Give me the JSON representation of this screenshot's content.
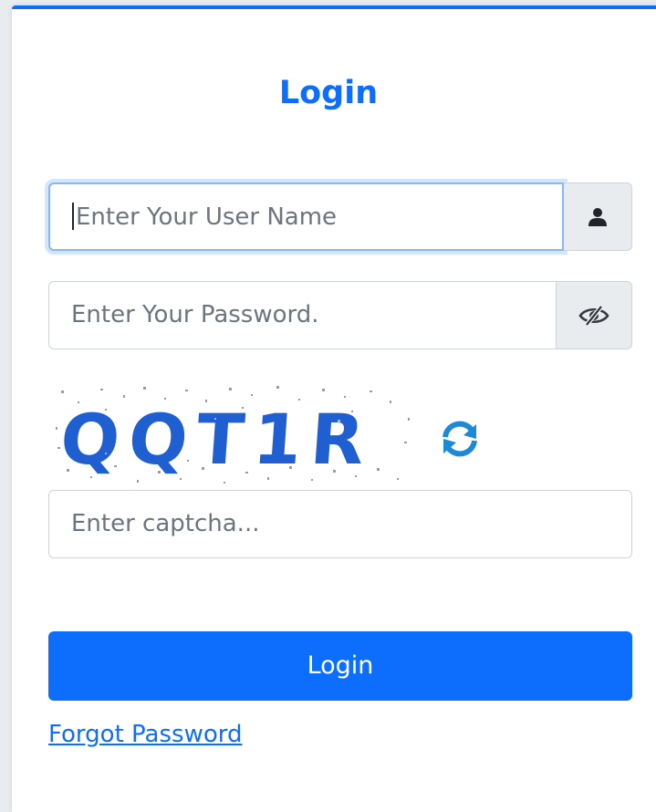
{
  "form": {
    "title": "Login",
    "username_placeholder": "Enter Your User Name",
    "password_placeholder": "Enter Your Password.",
    "captcha_text": "QQT1R",
    "captcha_placeholder": "Enter captcha...",
    "login_label": "Login",
    "forgot_label": "Forgot Password"
  },
  "icons": {
    "user": "user-icon",
    "password_toggle": "eye-slash-icon",
    "refresh": "refresh-icon"
  },
  "colors": {
    "primary": "#0d6efd",
    "addon_bg": "#e9ecef",
    "placeholder": "#6c757d"
  }
}
